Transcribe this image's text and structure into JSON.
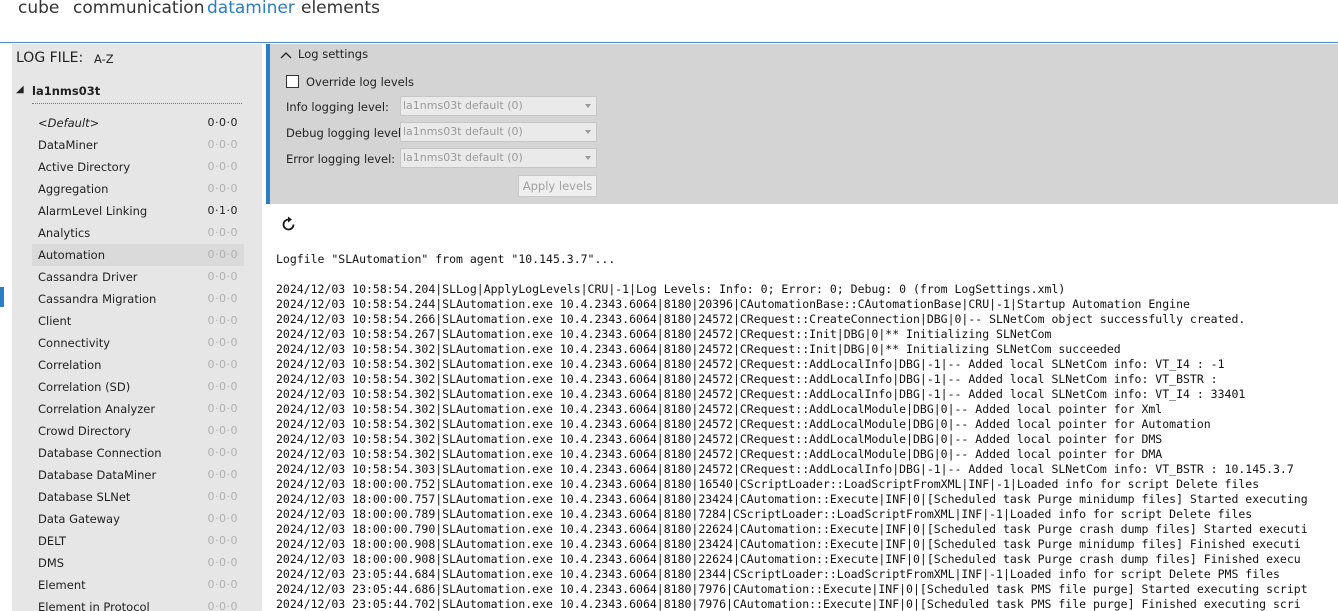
{
  "topnav": {
    "tabs": [
      {
        "label": "cube",
        "active": false
      },
      {
        "label": "communication",
        "active": false
      },
      {
        "label": "dataminer",
        "active": true
      },
      {
        "label": "elements",
        "active": false
      }
    ],
    "accent_color": "#2a7fc4"
  },
  "sidebar": {
    "title": "LOG FILE:",
    "sort": "A-Z",
    "host": {
      "toggle": "◢",
      "name": "la1nms03t"
    },
    "items": [
      {
        "label": "<Default>",
        "levels": "0·0·0",
        "italic": true,
        "set": true
      },
      {
        "label": "DataMiner",
        "levels": "0·0·0",
        "set": false
      },
      {
        "label": "Active Directory",
        "levels": "0·0·0",
        "set": false
      },
      {
        "label": "Aggregation",
        "levels": "0·0·0",
        "set": false
      },
      {
        "label": "AlarmLevel Linking",
        "levels": "0·1·0",
        "set": true
      },
      {
        "label": "Analytics",
        "levels": "0·0·0",
        "set": false
      },
      {
        "label": "Automation",
        "levels": "0·0·0",
        "set": false,
        "hover": true
      },
      {
        "label": "Cassandra Driver",
        "levels": "0·0·0",
        "set": false
      },
      {
        "label": "Cassandra Migration",
        "levels": "0·0·0",
        "set": false
      },
      {
        "label": "Client",
        "levels": "0·0·0",
        "set": false
      },
      {
        "label": "Connectivity",
        "levels": "0·0·0",
        "set": false
      },
      {
        "label": "Correlation",
        "levels": "0·0·0",
        "set": false
      },
      {
        "label": "Correlation (SD)",
        "levels": "0·0·0",
        "set": false
      },
      {
        "label": "Correlation Analyzer",
        "levels": "0·0·0",
        "set": false
      },
      {
        "label": "Crowd Directory",
        "levels": "0·0·0",
        "set": false
      },
      {
        "label": "Database Connection",
        "levels": "0·0·0",
        "set": false
      },
      {
        "label": "Database DataMiner",
        "levels": "0·0·0",
        "set": false
      },
      {
        "label": "Database SLNet",
        "levels": "0·0·0",
        "set": false
      },
      {
        "label": "Data Gateway",
        "levels": "0·0·0",
        "set": false
      },
      {
        "label": "DELT",
        "levels": "0·0·0",
        "set": false
      },
      {
        "label": "DMS",
        "levels": "0·0·0",
        "set": false
      },
      {
        "label": "Element",
        "levels": "0·0·0",
        "set": false
      },
      {
        "label": "Element in Protocol",
        "levels": "0·0·0",
        "set": false
      }
    ]
  },
  "settings": {
    "title": "Log settings",
    "override_label": "Override log levels",
    "override_checked": false,
    "fields": [
      {
        "label": "Info logging level:",
        "value": "la1nms03t default (0)"
      },
      {
        "label": "Debug logging level:",
        "value": "la1nms03t default (0)"
      },
      {
        "label": "Error logging level:",
        "value": "la1nms03t default (0)"
      }
    ],
    "apply_label": "Apply levels"
  },
  "log": {
    "heading": "Logfile \"SLAutomation\" from agent \"10.145.3.7\"...",
    "lines": [
      "2024/12/03 10:58:54.204|SLLog|ApplyLogLevels|CRU|-1|Log Levels: Info: 0; Error: 0; Debug: 0 (from LogSettings.xml)",
      "2024/12/03 10:58:54.244|SLAutomation.exe 10.4.2343.6064|8180|20396|CAutomationBase::CAutomationBase|CRU|-1|Startup Automation Engine",
      "2024/12/03 10:58:54.266|SLAutomation.exe 10.4.2343.6064|8180|24572|CRequest::CreateConnection|DBG|0|-- SLNetCom object successfully created.",
      "2024/12/03 10:58:54.267|SLAutomation.exe 10.4.2343.6064|8180|24572|CRequest::Init|DBG|0|** Initializing SLNetCom",
      "2024/12/03 10:58:54.302|SLAutomation.exe 10.4.2343.6064|8180|24572|CRequest::Init|DBG|0|** Initializing SLNetCom succeeded",
      "2024/12/03 10:58:54.302|SLAutomation.exe 10.4.2343.6064|8180|24572|CRequest::AddLocalInfo|DBG|-1|-- Added local SLNetCom info: VT_I4 : -1",
      "2024/12/03 10:58:54.302|SLAutomation.exe 10.4.2343.6064|8180|24572|CRequest::AddLocalInfo|DBG|-1|-- Added local SLNetCom info: VT_BSTR :",
      "2024/12/03 10:58:54.302|SLAutomation.exe 10.4.2343.6064|8180|24572|CRequest::AddLocalInfo|DBG|-1|-- Added local SLNetCom info: VT_I4 : 33401",
      "2024/12/03 10:58:54.302|SLAutomation.exe 10.4.2343.6064|8180|24572|CRequest::AddLocalModule|DBG|0|-- Added local pointer for Xml",
      "2024/12/03 10:58:54.302|SLAutomation.exe 10.4.2343.6064|8180|24572|CRequest::AddLocalModule|DBG|0|-- Added local pointer for Automation",
      "2024/12/03 10:58:54.302|SLAutomation.exe 10.4.2343.6064|8180|24572|CRequest::AddLocalModule|DBG|0|-- Added local pointer for DMS",
      "2024/12/03 10:58:54.302|SLAutomation.exe 10.4.2343.6064|8180|24572|CRequest::AddLocalModule|DBG|0|-- Added local pointer for DMA",
      "2024/12/03 10:58:54.303|SLAutomation.exe 10.4.2343.6064|8180|24572|CRequest::AddLocalInfo|DBG|-1|-- Added local SLNetCom info: VT_BSTR : 10.145.3.7",
      "2024/12/03 18:00:00.752|SLAutomation.exe 10.4.2343.6064|8180|16540|CScriptLoader::LoadScriptFromXML|INF|-1|Loaded info for script Delete files",
      "2024/12/03 18:00:00.757|SLAutomation.exe 10.4.2343.6064|8180|23424|CAutomation::Execute|INF|0|[Scheduled task Purge minidump files] Started executing",
      "2024/12/03 18:00:00.789|SLAutomation.exe 10.4.2343.6064|8180|7284|CScriptLoader::LoadScriptFromXML|INF|-1|Loaded info for script Delete files",
      "2024/12/03 18:00:00.790|SLAutomation.exe 10.4.2343.6064|8180|22624|CAutomation::Execute|INF|0|[Scheduled task Purge crash dump files] Started executi",
      "2024/12/03 18:00:00.908|SLAutomation.exe 10.4.2343.6064|8180|23424|CAutomation::Execute|INF|0|[Scheduled task Purge minidump files] Finished executi",
      "2024/12/03 18:00:00.908|SLAutomation.exe 10.4.2343.6064|8180|22624|CAutomation::Execute|INF|0|[Scheduled task Purge crash dump files] Finished execu",
      "2024/12/03 23:05:44.684|SLAutomation.exe 10.4.2343.6064|8180|2344|CScriptLoader::LoadScriptFromXML|INF|-1|Loaded info for script Delete PMS files",
      "2024/12/03 23:05:44.686|SLAutomation.exe 10.4.2343.6064|8180|7976|CAutomation::Execute|INF|0|[Scheduled task PMS file purge] Started executing script",
      "2024/12/03 23:05:44.702|SLAutomation.exe 10.4.2343.6064|8180|7976|CAutomation::Execute|INF|0|[Scheduled task PMS file purge] Finished executing scri"
    ]
  }
}
